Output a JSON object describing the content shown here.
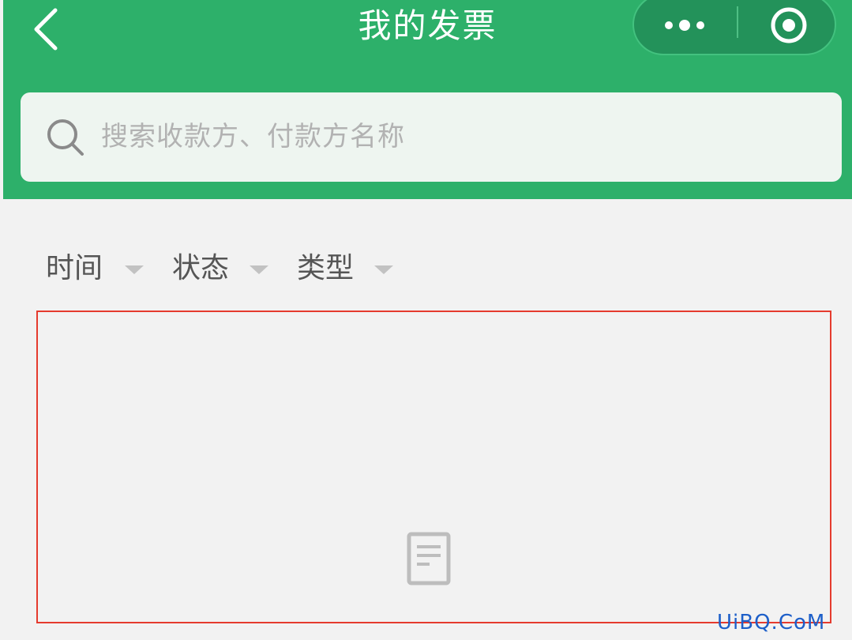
{
  "header": {
    "title": "我的发票",
    "background_color": "#2db06a",
    "back_icon": "chevron-left-icon",
    "capsule": {
      "more_icon": "more-dots-icon",
      "close_icon": "target-circle-icon"
    }
  },
  "search": {
    "placeholder": "搜索收款方、付款方名称",
    "icon": "search-icon"
  },
  "filters": [
    {
      "label": "时间"
    },
    {
      "label": "状态"
    },
    {
      "label": "类型"
    }
  ],
  "content": {
    "empty_icon": "document-icon",
    "highlight_color": "#e53b2e"
  },
  "watermark": {
    "text": "UiBQ.CoM"
  }
}
